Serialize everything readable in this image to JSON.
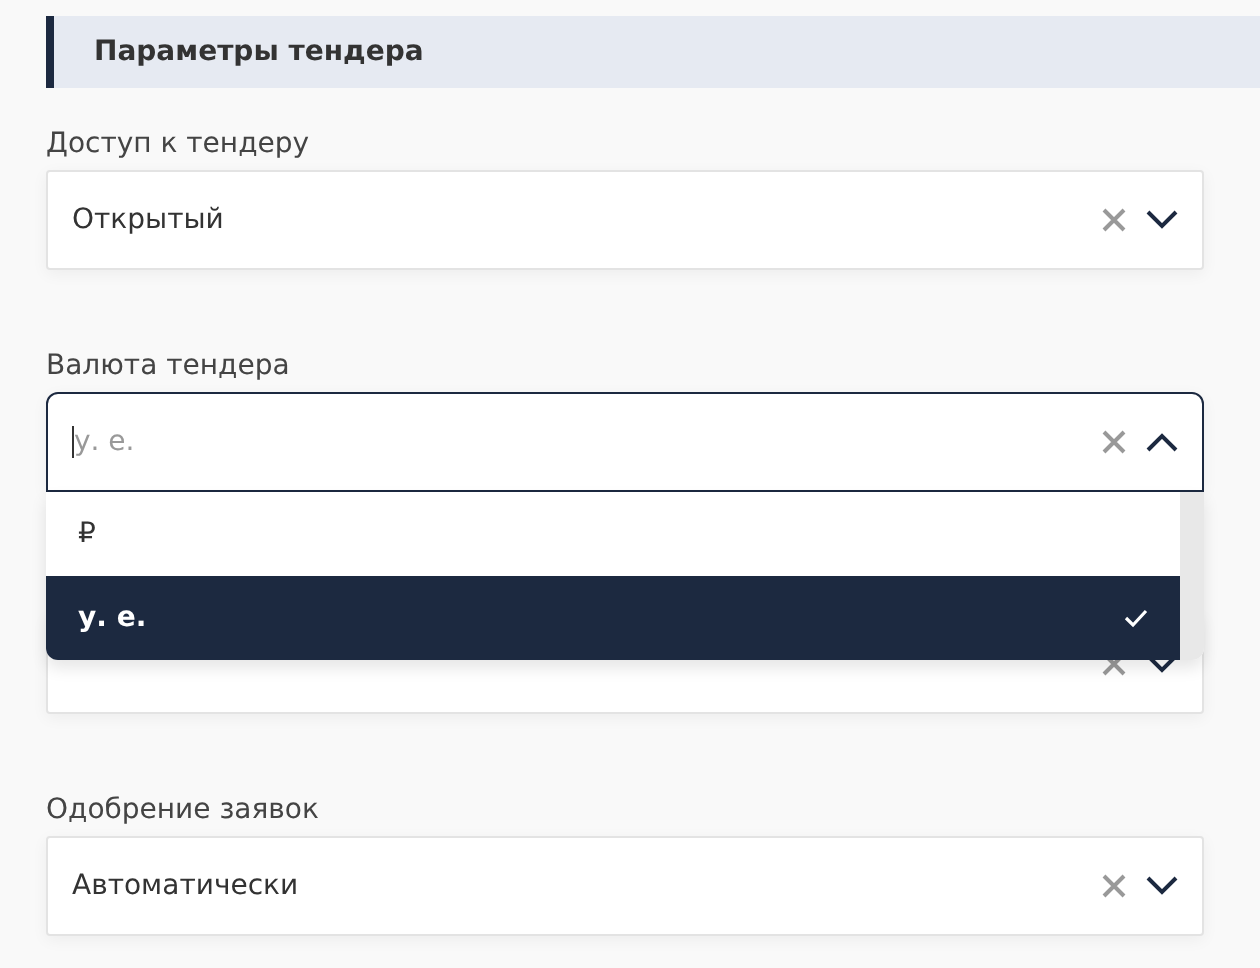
{
  "section": {
    "title": "Параметры тендера"
  },
  "fields": [
    {
      "label": "Доступ к тендеру",
      "value": "Открытый",
      "expanded": false
    },
    {
      "label": "Валюта тендера",
      "value": "у. е.",
      "expanded": true,
      "options": [
        {
          "label": "₽",
          "selected": false
        },
        {
          "label": "у. е.",
          "selected": true
        }
      ]
    },
    {
      "expanded": false
    },
    {
      "label": "Одобрение заявок",
      "value": "Автоматически",
      "expanded": false
    }
  ]
}
